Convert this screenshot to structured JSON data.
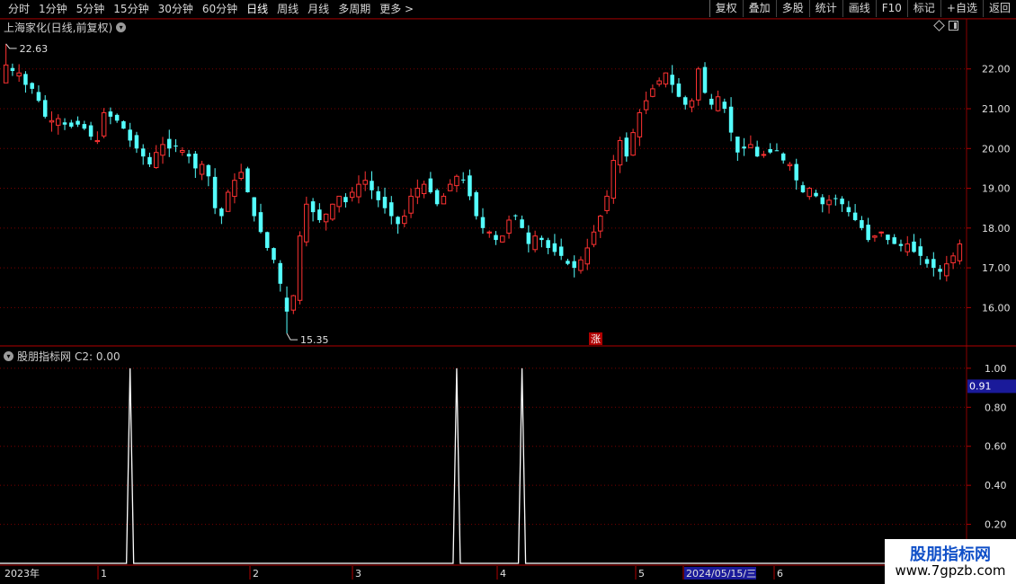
{
  "toolbar": {
    "periods": [
      "分时",
      "1分钟",
      "5分钟",
      "15分钟",
      "30分钟",
      "60分钟",
      "日线",
      "周线",
      "月线",
      "多周期",
      "更多 >"
    ],
    "active_period": "日线",
    "buttons": [
      "复权",
      "叠加",
      "多股",
      "统计",
      "画线",
      "F10",
      "标记",
      "+自选",
      "返回"
    ]
  },
  "main_chart": {
    "title": "上海家化(日线,前复权)",
    "high_label": "22.63",
    "low_label": "15.35",
    "rise_marker": "涨",
    "y_ticks": [
      "22.00",
      "21.00",
      "20.00",
      "19.00",
      "18.00",
      "17.00",
      "16.00"
    ]
  },
  "indicator": {
    "title": "股朋指标网",
    "value_label": "C2: 0.00",
    "y_ticks": [
      "1.00",
      "0.80",
      "0.60",
      "0.40",
      "0.20"
    ],
    "current_value": "0.91"
  },
  "x_axis": {
    "labels": [
      "2023年",
      "1",
      "2",
      "3",
      "4",
      "5",
      "2024/05/15/三",
      "6"
    ]
  },
  "watermark": {
    "title": "股朋指标网",
    "url": "www.7gpzb.com"
  },
  "colors": {
    "up": "#ff3232",
    "down": "#54ffff",
    "grid": "#7a0000",
    "axis_text": "#e0e0e0"
  },
  "chart_data": {
    "type": "candlestick",
    "price_range": [
      15.35,
      22.63
    ],
    "candles_close": [
      22.1,
      21.95,
      21.9,
      21.6,
      21.5,
      21.2,
      20.8,
      20.7,
      20.75,
      20.6,
      20.55,
      20.6,
      20.5,
      20.3,
      20.2,
      20.9,
      20.8,
      20.7,
      20.5,
      20.2,
      20.0,
      19.8,
      19.6,
      19.9,
      20.1,
      20.0,
      20.05,
      19.95,
      19.8,
      19.5,
      19.6,
      19.3,
      18.5,
      18.3,
      18.9,
      19.2,
      19.4,
      18.9,
      18.3,
      17.9,
      17.5,
      17.2,
      16.6,
      15.9,
      16.3,
      17.8,
      18.6,
      18.4,
      18.2,
      18.35,
      18.6,
      18.8,
      18.65,
      18.9,
      19.1,
      19.2,
      18.95,
      18.7,
      18.5,
      18.3,
      18.1,
      18.3,
      18.8,
      19.0,
      19.1,
      18.9,
      18.6,
      18.8,
      19.1,
      19.3,
      19.2,
      18.8,
      18.3,
      18.0,
      17.9,
      17.7,
      17.8,
      18.2,
      18.3,
      18.0,
      17.6,
      17.8,
      17.7,
      17.5,
      17.4,
      17.3,
      17.1,
      17.0,
      17.2,
      17.5,
      17.9,
      18.3,
      18.8,
      19.7,
      20.2,
      19.8,
      20.4,
      20.9,
      21.2,
      21.5,
      21.7,
      21.9,
      21.6,
      21.3,
      21.1,
      21.2,
      22.0,
      21.4,
      21.1,
      21.3,
      21.0,
      20.4,
      19.9,
      20.0,
      20.1,
      19.8,
      19.85,
      19.9,
      19.95,
      19.7,
      19.6,
      19.2,
      18.9,
      19.0,
      18.8,
      18.6,
      18.7,
      18.75,
      18.6,
      18.4,
      18.2,
      18.0,
      17.7,
      17.8,
      17.9,
      17.7,
      17.6,
      17.55,
      17.6,
      17.4,
      17.3,
      17.1,
      17.0,
      16.9,
      17.1,
      17.3,
      17.6
    ],
    "indicator_c2": {
      "x_categories": "bar index",
      "spikes_at": [
        19,
        69,
        79
      ],
      "values": "0 except 1.00 at spikes"
    }
  }
}
